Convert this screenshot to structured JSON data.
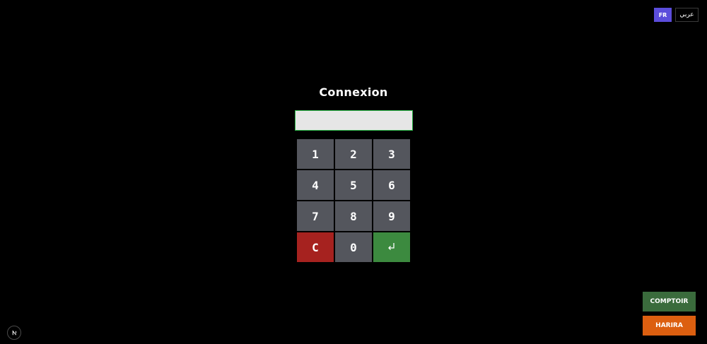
{
  "language_switch": {
    "fr_label": "FR",
    "ar_label": "عربي",
    "active": "FR",
    "active_color": "#5b4ddb"
  },
  "login": {
    "title": "Connexion",
    "pin_value": "",
    "pin_placeholder": ""
  },
  "keypad": {
    "keys": [
      "1",
      "2",
      "3",
      "4",
      "5",
      "6",
      "7",
      "8",
      "9",
      "C",
      "0",
      "enter-icon"
    ],
    "clear_color": "#a6221f",
    "enter_color": "#3c8a3f",
    "key_color": "#54565d"
  },
  "actions": {
    "comptoir_label": "COMPTOIR",
    "harira_label": "HARIRA",
    "comptoir_color": "#3a6b3c",
    "harira_color": "#dc5f10"
  },
  "badge": {
    "icon": "nextjs-logo-icon"
  }
}
